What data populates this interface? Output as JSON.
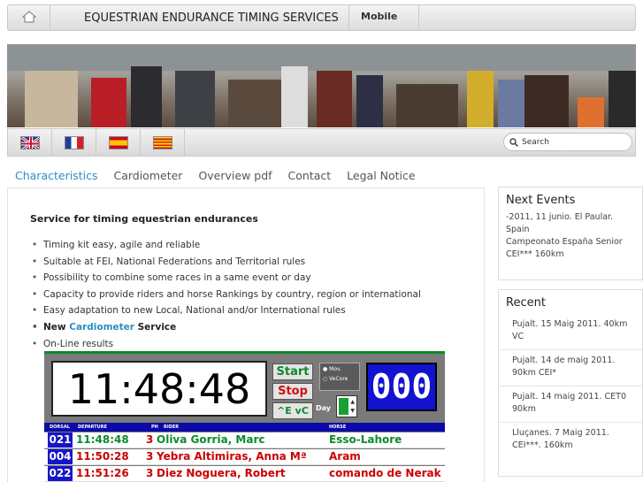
{
  "header": {
    "title": "EQUESTRIAN ENDURANCE TIMING SERVICES",
    "mobile_label": "Mobile"
  },
  "search": {
    "placeholder": "Search"
  },
  "languages": [
    "english-flag",
    "french-flag",
    "spanish-flag",
    "catalan-flag"
  ],
  "nav": {
    "items": [
      "Characteristics",
      "Cardiometer",
      "Overview pdf",
      "Contact",
      "Legal Notice"
    ],
    "active": "Characteristics"
  },
  "main": {
    "heading": "Service for timing equestrian endurances",
    "bullets": [
      "Timing kit easy, agile and reliable",
      "Suitable at FEI, National Federations and Territorial rules",
      "Possibility to combine some races in a same event or day",
      "Capacity to provide riders and horse Rankings by country, region or international",
      "Easy adaptation to new Local, National and/or International rules"
    ],
    "cardio": {
      "prefix": "New",
      "link": "Cardiometer",
      "suffix": "Service"
    },
    "last_bullet": "On-Line results"
  },
  "board": {
    "clock": "11:48:48",
    "start_label": "Start",
    "stop_label": "Stop",
    "vc_label": "^E vC",
    "radio_1": "Mov.",
    "radio_2": "VeCore",
    "day_label": "Day",
    "counter": "000",
    "headers": {
      "dorsal": "DORSAL",
      "departure": "DEPARTURE",
      "ph": "PH",
      "rider": "RIDER",
      "horse": "HORSE"
    },
    "rows": [
      {
        "dorsal": "021",
        "departure": "11:48:48",
        "ph": "3",
        "rider": "Oliva Gorria, Marc",
        "horse": "Esso-Lahore"
      },
      {
        "dorsal": "004",
        "departure": "11:50:28",
        "ph": "3",
        "rider": "Yebra Altimiras, Anna Mª",
        "horse": "Aram"
      },
      {
        "dorsal": "022",
        "departure": "11:51:26",
        "ph": "3",
        "rider": "Diez Noguera, Robert",
        "horse": "comando de Nerak"
      }
    ],
    "colors": {
      "border": "#0b8a2b",
      "start": "#0b8a2b",
      "stop": "#d01010",
      "counter_bg": "#1212d0"
    }
  },
  "sidebar": {
    "next_events": {
      "title": "Next Events",
      "line1": "-2011, 11 junio. El Paular. Spain",
      "line2": "Campeonato España Senior CEI*** 160km"
    },
    "recent": {
      "title": "Recent",
      "items": [
        "Pujalt. 15 Maig 2011. 40km VC",
        "Pujalt. 14 de maig 2011. 90km CEI*",
        "Pujalt. 14 maig 2011. CET0 90km",
        "Lluçanes. 7 Maig 2011. CEI***. 160km"
      ]
    }
  },
  "colors": {
    "accent": "#2a8fbf"
  }
}
